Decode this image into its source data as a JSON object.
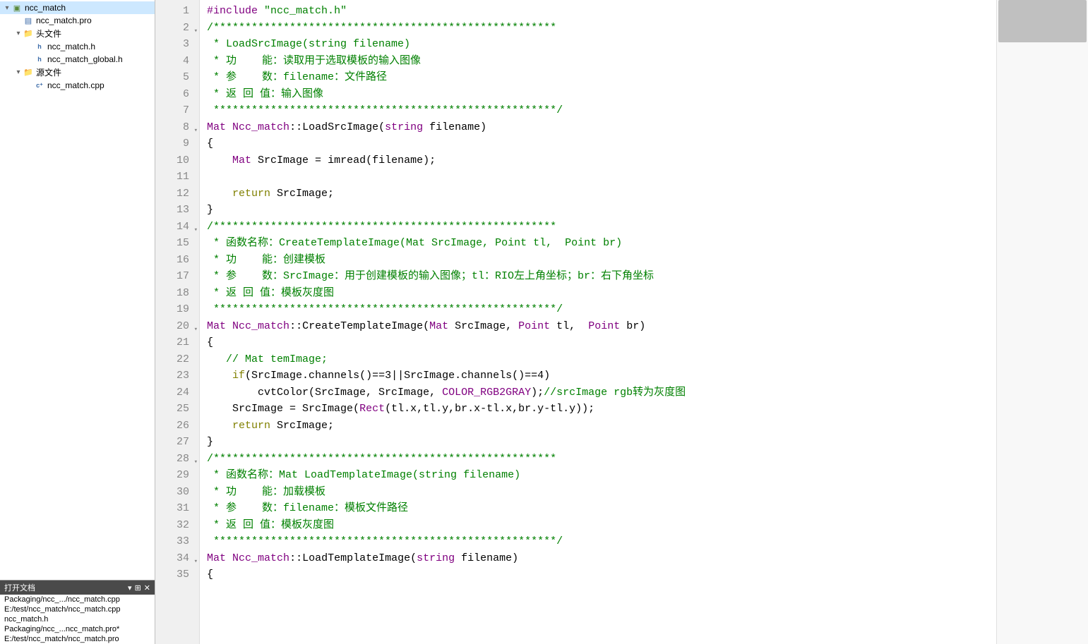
{
  "sidebar": {
    "project": {
      "name": "ncc_match",
      "items": [
        {
          "indent": 0,
          "arrow": "▾",
          "icon": "project",
          "label": "ncc_match",
          "selected": true
        },
        {
          "indent": 1,
          "arrow": "",
          "icon": "pro",
          "label": "ncc_match.pro"
        },
        {
          "indent": 1,
          "arrow": "▾",
          "icon": "folder",
          "label": "头文件"
        },
        {
          "indent": 2,
          "arrow": "",
          "icon": "h",
          "label": "ncc_match.h"
        },
        {
          "indent": 2,
          "arrow": "",
          "icon": "h",
          "label": "ncc_match_global.h"
        },
        {
          "indent": 1,
          "arrow": "▾",
          "icon": "folder",
          "label": "源文件"
        },
        {
          "indent": 2,
          "arrow": "",
          "icon": "cpp",
          "label": "ncc_match.cpp"
        }
      ]
    },
    "openDocs": {
      "title": "打开文档",
      "items": [
        "Packaging/ncc_.../ncc_match.cpp",
        "E:/test/ncc_match/ncc_match.cpp",
        "ncc_match.h",
        "Packaging/ncc_...ncc_match.pro*",
        "E:/test/ncc_match/ncc_match.pro"
      ]
    }
  },
  "code": {
    "lines": [
      {
        "n": 1,
        "fold": "",
        "tokens": [
          [
            "pp",
            "#include"
          ],
          [
            "",
            " "
          ],
          [
            "str",
            "\"ncc_match.h\""
          ]
        ]
      },
      {
        "n": 2,
        "fold": "▾",
        "tokens": [
          [
            "cmt",
            "/******************************************************"
          ]
        ]
      },
      {
        "n": 3,
        "fold": "",
        "tokens": [
          [
            "cmt",
            " * LoadSrcImage(string filename)"
          ]
        ]
      },
      {
        "n": 4,
        "fold": "",
        "tokens": [
          [
            "cmt",
            " * 功    能：读取用于选取模板的输入图像"
          ]
        ]
      },
      {
        "n": 5,
        "fold": "",
        "tokens": [
          [
            "cmt",
            " * 参    数：filename：文件路径"
          ]
        ]
      },
      {
        "n": 6,
        "fold": "",
        "tokens": [
          [
            "cmt",
            " * 返 回 值：输入图像"
          ]
        ]
      },
      {
        "n": 7,
        "fold": "",
        "tokens": [
          [
            "cmt",
            " ******************************************************/"
          ]
        ]
      },
      {
        "n": 8,
        "fold": "▾",
        "tokens": [
          [
            "type",
            "Mat"
          ],
          [
            "",
            " "
          ],
          [
            "cls",
            "Ncc_match"
          ],
          [
            "",
            "::LoadSrcImage("
          ],
          [
            "type",
            "string"
          ],
          [
            "",
            " filename)"
          ]
        ]
      },
      {
        "n": 9,
        "fold": "",
        "tokens": [
          [
            "",
            "{"
          ]
        ]
      },
      {
        "n": 10,
        "fold": "",
        "tokens": [
          [
            "",
            "    "
          ],
          [
            "type",
            "Mat"
          ],
          [
            "",
            " SrcImage = imread(filename);"
          ]
        ]
      },
      {
        "n": 11,
        "fold": "",
        "tokens": [
          [
            "",
            ""
          ]
        ]
      },
      {
        "n": 12,
        "fold": "",
        "tokens": [
          [
            "",
            "    "
          ],
          [
            "kw",
            "return"
          ],
          [
            "",
            " SrcImage;"
          ]
        ]
      },
      {
        "n": 13,
        "fold": "",
        "tokens": [
          [
            "",
            "}"
          ]
        ]
      },
      {
        "n": 14,
        "fold": "▾",
        "tokens": [
          [
            "cmt",
            "/******************************************************"
          ]
        ]
      },
      {
        "n": 15,
        "fold": "",
        "tokens": [
          [
            "cmt",
            " * 函数名称：CreateTemplateImage(Mat SrcImage, Point tl,  Point br)"
          ]
        ]
      },
      {
        "n": 16,
        "fold": "",
        "tokens": [
          [
            "cmt",
            " * 功    能：创建模板"
          ]
        ]
      },
      {
        "n": 17,
        "fold": "",
        "tokens": [
          [
            "cmt",
            " * 参    数：SrcImage：用于创建模板的输入图像；tl：RIO左上角坐标；br：右下角坐标"
          ]
        ]
      },
      {
        "n": 18,
        "fold": "",
        "tokens": [
          [
            "cmt",
            " * 返 回 值：模板灰度图"
          ]
        ]
      },
      {
        "n": 19,
        "fold": "",
        "tokens": [
          [
            "cmt",
            " ******************************************************/"
          ]
        ]
      },
      {
        "n": 20,
        "fold": "▾",
        "tokens": [
          [
            "type",
            "Mat"
          ],
          [
            "",
            " "
          ],
          [
            "cls",
            "Ncc_match"
          ],
          [
            "",
            "::CreateTemplateImage("
          ],
          [
            "type",
            "Mat"
          ],
          [
            "",
            " SrcImage, "
          ],
          [
            "type",
            "Point"
          ],
          [
            "",
            " tl,  "
          ],
          [
            "type",
            "Point"
          ],
          [
            "",
            " br)"
          ]
        ]
      },
      {
        "n": 21,
        "fold": "",
        "tokens": [
          [
            "",
            "{"
          ]
        ]
      },
      {
        "n": 22,
        "fold": "",
        "tokens": [
          [
            "",
            "   "
          ],
          [
            "cmt",
            "// Mat temImage;"
          ]
        ]
      },
      {
        "n": 23,
        "fold": "",
        "tokens": [
          [
            "",
            "    "
          ],
          [
            "kw",
            "if"
          ],
          [
            "",
            "(SrcImage.channels()==3||SrcImage.channels()==4)"
          ]
        ]
      },
      {
        "n": 24,
        "fold": "",
        "tokens": [
          [
            "",
            "        cvtColor(SrcImage, SrcImage, "
          ],
          [
            "const",
            "COLOR_RGB2GRAY"
          ],
          [
            "",
            ");"
          ],
          [
            "cmt",
            "//srcImage rgb转为灰度图"
          ]
        ]
      },
      {
        "n": 25,
        "fold": "",
        "tokens": [
          [
            "",
            "    SrcImage = SrcImage("
          ],
          [
            "type",
            "Rect"
          ],
          [
            "",
            "(tl.x,tl.y,br.x-tl.x,br.y-tl.y));"
          ]
        ]
      },
      {
        "n": 26,
        "fold": "",
        "tokens": [
          [
            "",
            "    "
          ],
          [
            "kw",
            "return"
          ],
          [
            "",
            " SrcImage;"
          ]
        ]
      },
      {
        "n": 27,
        "fold": "",
        "tokens": [
          [
            "",
            "}"
          ]
        ]
      },
      {
        "n": 28,
        "fold": "▾",
        "tokens": [
          [
            "cmt",
            "/******************************************************"
          ]
        ]
      },
      {
        "n": 29,
        "fold": "",
        "tokens": [
          [
            "cmt",
            " * 函数名称：Mat LoadTemplateImage(string filename)"
          ]
        ]
      },
      {
        "n": 30,
        "fold": "",
        "tokens": [
          [
            "cmt",
            " * 功    能：加载模板"
          ]
        ]
      },
      {
        "n": 31,
        "fold": "",
        "tokens": [
          [
            "cmt",
            " * 参    数：filename：模板文件路径"
          ]
        ]
      },
      {
        "n": 32,
        "fold": "",
        "tokens": [
          [
            "cmt",
            " * 返 回 值：模板灰度图"
          ]
        ]
      },
      {
        "n": 33,
        "fold": "",
        "tokens": [
          [
            "cmt",
            " ******************************************************/"
          ]
        ]
      },
      {
        "n": 34,
        "fold": "▾",
        "tokens": [
          [
            "type",
            "Mat"
          ],
          [
            "",
            " "
          ],
          [
            "cls",
            "Ncc_match"
          ],
          [
            "",
            "::LoadTemplateImage("
          ],
          [
            "type",
            "string"
          ],
          [
            "",
            " filename)"
          ]
        ]
      },
      {
        "n": 35,
        "fold": "",
        "tokens": [
          [
            "",
            "{"
          ]
        ]
      }
    ]
  }
}
